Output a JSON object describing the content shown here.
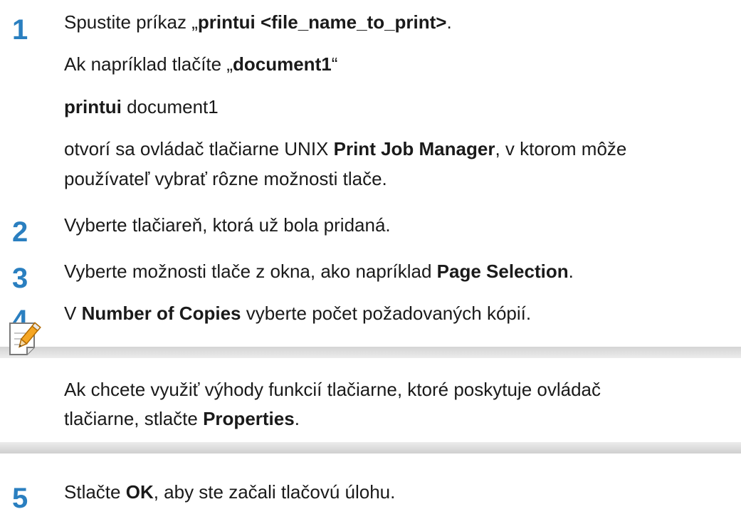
{
  "steps": [
    {
      "number": "1",
      "lines": [
        [
          [
            "Spustite príkaz „",
            false
          ],
          [
            "printui <file_name_to_print>",
            true
          ],
          [
            ".",
            false
          ]
        ],
        [
          [
            "Ak napríklad tlačíte „",
            false
          ],
          [
            "document1",
            true
          ],
          [
            "“",
            false
          ]
        ],
        [
          [
            "printui",
            true
          ],
          [
            " document1",
            false
          ]
        ],
        [
          [
            "otvorí sa ovládač tlačiarne UNIX ",
            false
          ],
          [
            "Print Job Manager",
            true
          ],
          [
            ", v ktorom môže",
            false
          ]
        ],
        [
          [
            "používateľ vybrať rôzne možnosti tlače.",
            false
          ]
        ]
      ]
    },
    {
      "number": "2",
      "lines": [
        [
          [
            "Vyberte tlačiareň, ktorá už bola pridaná.",
            false
          ]
        ]
      ]
    },
    {
      "number": "3",
      "lines": [
        [
          [
            "Vyberte možnosti tlače z okna, ako napríklad ",
            false
          ],
          [
            "Page Selection",
            true
          ],
          [
            ".",
            false
          ]
        ]
      ]
    },
    {
      "number": "4",
      "lines": [
        [
          [
            "V ",
            false
          ],
          [
            "Number of Copies",
            true
          ],
          [
            " vyberte počet požadovaných kópií.",
            false
          ]
        ]
      ]
    },
    {
      "number": "5",
      "lines": [
        [
          [
            "Stlačte ",
            false
          ],
          [
            "OK",
            true
          ],
          [
            ", aby ste začali tlačovú úlohu.",
            false
          ]
        ]
      ]
    }
  ],
  "note": {
    "icon": "note-pencil-icon",
    "lines": [
      [
        [
          "Ak chcete využiť výhody funkcií tlačiarne, ktoré poskytuje ovládač",
          false
        ]
      ],
      [
        [
          "tlačiarne, stlačte ",
          false
        ],
        [
          "Properties",
          true
        ],
        [
          ".",
          false
        ]
      ]
    ]
  },
  "colors": {
    "step_number": "#2a7fc0",
    "text": "#1a1a1a",
    "note_band": "#d8d8d8"
  }
}
